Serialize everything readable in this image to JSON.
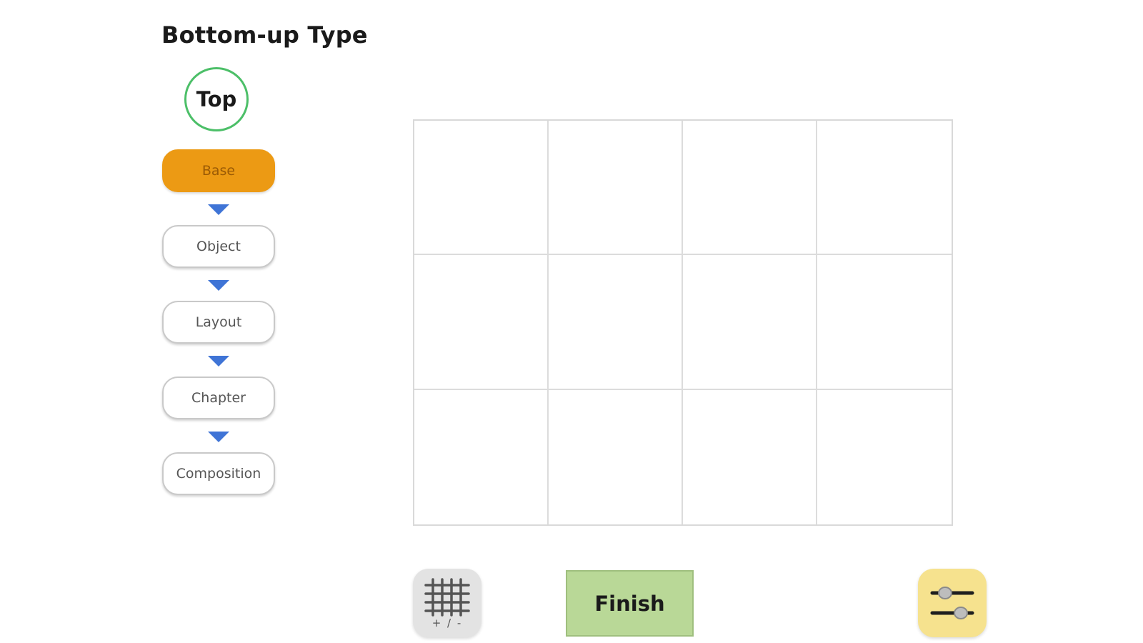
{
  "header": {
    "title": "Bottom-up Type"
  },
  "hierarchy": {
    "top_label": "Top",
    "stages": [
      {
        "label": "Base",
        "active": true
      },
      {
        "label": "Object",
        "active": false
      },
      {
        "label": "Layout",
        "active": false
      },
      {
        "label": "Chapter",
        "active": false
      },
      {
        "label": "Composition",
        "active": false
      }
    ],
    "arrow_icon": "triangle-down-icon"
  },
  "grid": {
    "columns": 4,
    "rows": 3
  },
  "toolbar": {
    "grid_toggle_icon": "grid-icon",
    "grid_toggle_label": "+ / -",
    "finish_label": "Finish",
    "settings_icon": "sliders-icon"
  },
  "colors": {
    "active_stage": "#ec9a14",
    "top_circle": "#4cbf68",
    "arrow": "#3f74d6",
    "finish": "#b9d897",
    "settings": "#f6e28e"
  }
}
